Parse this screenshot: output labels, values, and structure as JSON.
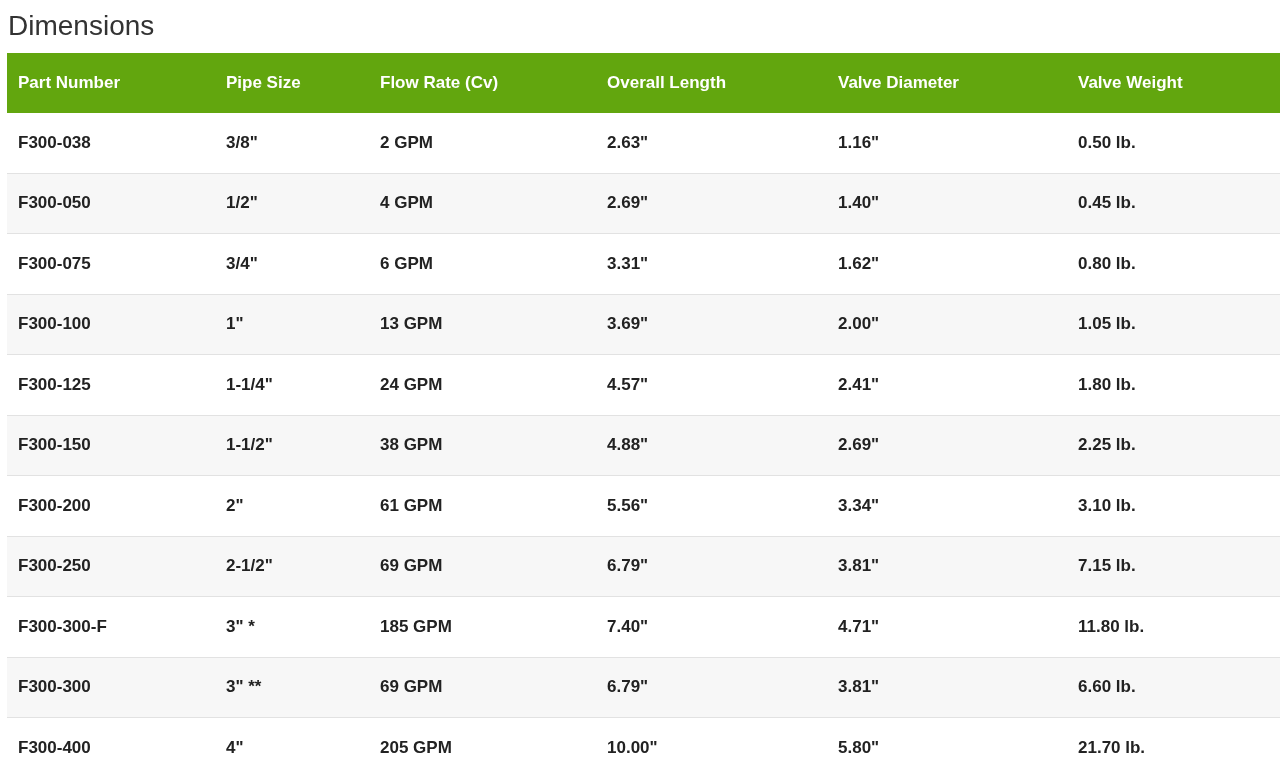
{
  "title": "Dimensions",
  "table": {
    "columns": [
      "Part Number",
      "Pipe Size",
      "Flow Rate (Cv)",
      "Overall Length",
      "Valve Diameter",
      "Valve Weight"
    ],
    "rows": [
      [
        "F300-038",
        "3/8\"",
        "2 GPM",
        "2.63\"",
        "1.16\"",
        "0.50 lb."
      ],
      [
        "F300-050",
        "1/2\"",
        "4 GPM",
        "2.69\"",
        "1.40\"",
        "0.45 lb."
      ],
      [
        "F300-075",
        "3/4\"",
        "6 GPM",
        "3.31\"",
        "1.62\"",
        "0.80 lb."
      ],
      [
        "F300-100",
        "1\"",
        "13 GPM",
        "3.69\"",
        "2.00\"",
        "1.05 lb."
      ],
      [
        "F300-125",
        "1-1/4\"",
        "24 GPM",
        "4.57\"",
        "2.41\"",
        "1.80 lb."
      ],
      [
        "F300-150",
        "1-1/2\"",
        "38 GPM",
        "4.88\"",
        "2.69\"",
        "2.25 lb."
      ],
      [
        "F300-200",
        "2\"",
        "61 GPM",
        "5.56\"",
        "3.34\"",
        "3.10 lb."
      ],
      [
        "F300-250",
        "2-1/2\"",
        "69 GPM",
        "6.79\"",
        "3.81\"",
        "7.15 lb."
      ],
      [
        "F300-300-F",
        "3\" *",
        "185 GPM",
        "7.40\"",
        "4.71\"",
        "11.80 lb."
      ],
      [
        "F300-300",
        "3\" **",
        "69 GPM",
        "6.79\"",
        "3.81\"",
        "6.60 lb."
      ],
      [
        "F300-400",
        "4\"",
        "205 GPM",
        "10.00\"",
        "5.80\"",
        "21.70 lb."
      ]
    ]
  }
}
